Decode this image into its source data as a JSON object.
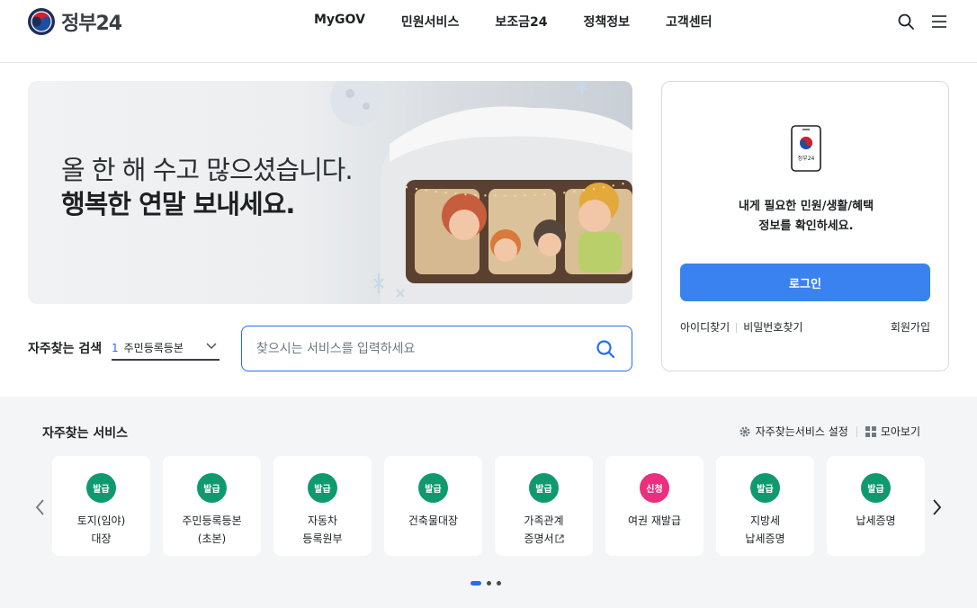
{
  "header": {
    "logo_text": "정부24",
    "nav": [
      "MyGOV",
      "민원서비스",
      "보조금24",
      "정책정보",
      "고객센터"
    ]
  },
  "banner": {
    "line1": "올 한 해 수고 많으셨습니다.",
    "line2": "행복한 연말 보내세요."
  },
  "search": {
    "label": "자주찾는 검색",
    "selected_rank": "1",
    "selected_keyword": "주민등록등본",
    "placeholder": "찾으시는 서비스를 입력하세요"
  },
  "login": {
    "phone_text": "정부24",
    "message_line1": "내게 필요한 민원/생활/혜택",
    "message_line2": "정보를 확인하세요.",
    "login_button": "로그인",
    "find_id": "아이디찾기",
    "find_password": "비밀번호찾기",
    "join": "회원가입"
  },
  "services": {
    "title": "자주찾는 서비스",
    "settings_label": "자주찾는서비스 설정",
    "view_all_label": "모아보기",
    "cards": [
      {
        "badge": "발급",
        "badge_type": "issue",
        "line1": "토지(임야)",
        "line2": "대장"
      },
      {
        "badge": "발급",
        "badge_type": "issue",
        "line1": "주민등록등본",
        "line2": "(초본)"
      },
      {
        "badge": "발급",
        "badge_type": "issue",
        "line1": "자동차",
        "line2": "등록원부"
      },
      {
        "badge": "발급",
        "badge_type": "issue",
        "line1": "건축물대장",
        "line2": ""
      },
      {
        "badge": "발급",
        "badge_type": "issue",
        "line1": "가족관계",
        "line2": "증명서"
      },
      {
        "badge": "신청",
        "badge_type": "apply",
        "line1": "여권 재발급",
        "line2": ""
      },
      {
        "badge": "발급",
        "badge_type": "issue",
        "line1": "지방세",
        "line2": "납세증명"
      },
      {
        "badge": "발급",
        "badge_type": "issue",
        "line1": "납세증명",
        "line2": ""
      }
    ],
    "pagination_count": 3,
    "pagination_active": 1
  },
  "colors": {
    "primary": "#256ef4",
    "login_button": "#3a82f0",
    "issue_badge": "#0f9a6e",
    "apply_badge": "#eb2f7e",
    "section_bg": "#f4f5f6"
  },
  "icons": {
    "logo": "taegeuk-logo-icon",
    "search": "search-icon",
    "menu": "hamburger-menu-icon",
    "select": "chevron-down-icon",
    "phone": "mobile-phone-icon",
    "settings": "gear-icon",
    "view_all": "grid-icon",
    "prev": "chevron-left-icon",
    "next": "chevron-right-icon",
    "external": "external-link-icon"
  }
}
